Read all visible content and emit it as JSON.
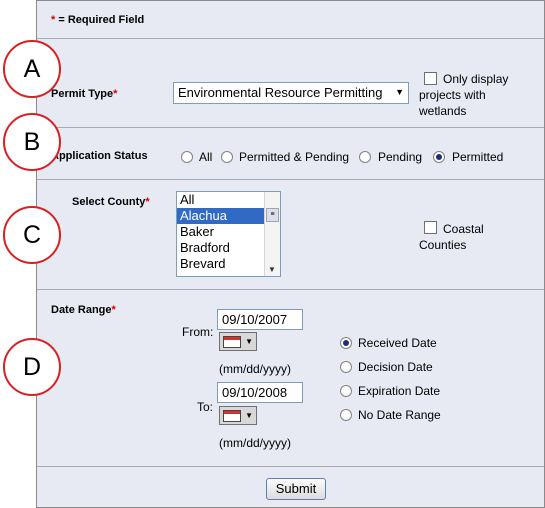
{
  "required_note": {
    "asterisk": "*",
    "text": " = Required Field"
  },
  "markers": [
    "A",
    "B",
    "C",
    "D"
  ],
  "permit_type": {
    "label": "Permit Type",
    "selected": "Environmental Resource Permitting",
    "wetlands_checkbox": {
      "checked": false,
      "line1": "Only display",
      "line2": "projects with",
      "line3": "wetlands"
    }
  },
  "application_status": {
    "label": "Application Status",
    "options": [
      "All",
      "Permitted & Pending",
      "Pending",
      "Permitted"
    ],
    "selected": "Permitted"
  },
  "county": {
    "label": "Select County",
    "items": [
      "All",
      "Alachua",
      "Baker",
      "Bradford",
      "Brevard"
    ],
    "selected": "Alachua",
    "coastal_checkbox": {
      "checked": false,
      "line1": "Coastal",
      "line2": "Counties"
    }
  },
  "date_range": {
    "label": "Date Range",
    "from_label": "From:",
    "from_value": "09/10/2007",
    "to_label": "To:",
    "to_value": "09/10/2008",
    "format_hint": "(mm/dd/yyyy)",
    "date_types": [
      "Received Date",
      "Decision Date",
      "Expiration Date",
      "No Date Range"
    ],
    "selected_type": "Received Date"
  },
  "submit_label": "Submit",
  "colors": {
    "required": "#d40000",
    "marker_ring": "#d82020",
    "panel": "#e8eaf3"
  }
}
